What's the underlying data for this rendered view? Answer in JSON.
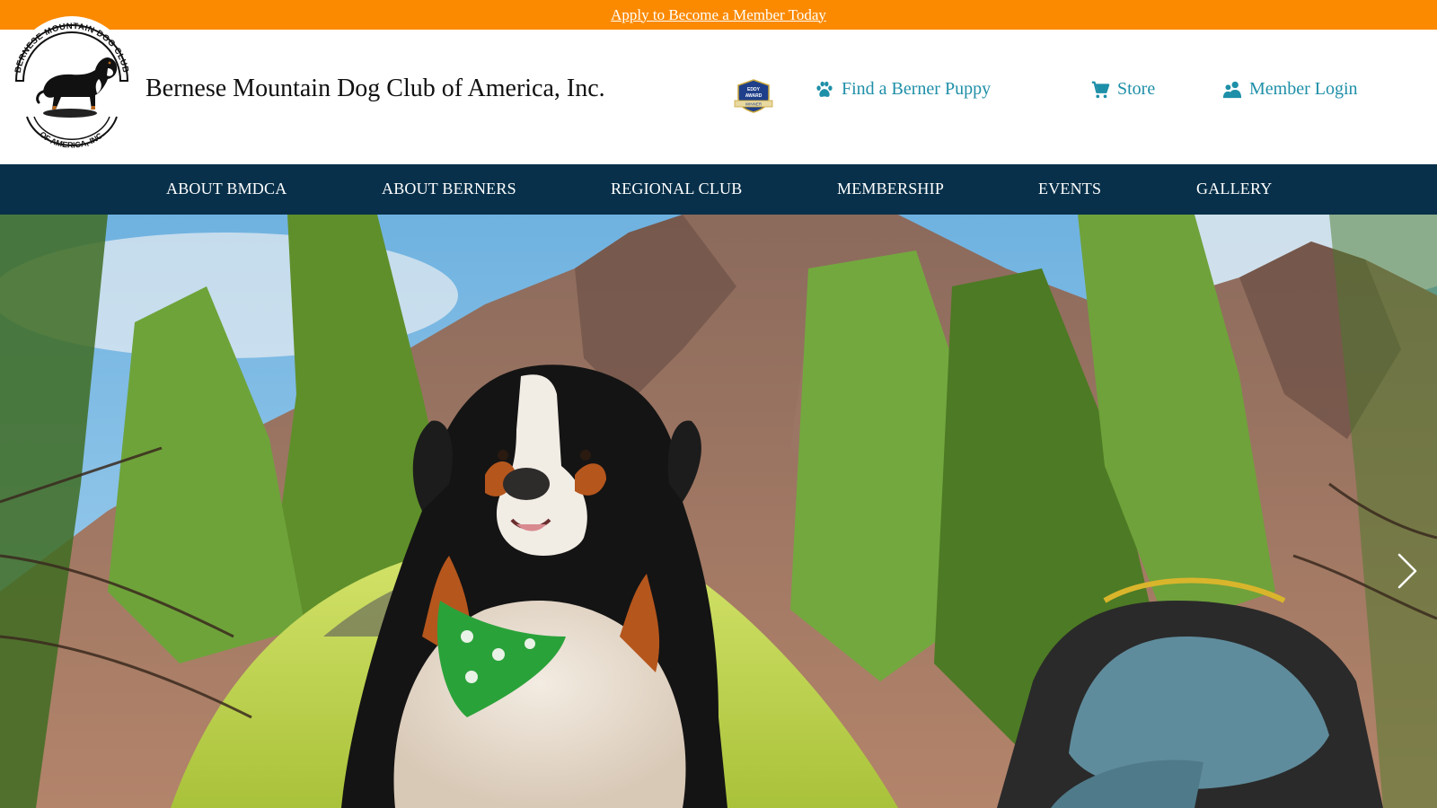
{
  "announcement": {
    "link_text": "Apply to Become a Member Today"
  },
  "header": {
    "logo_text_top": "BERNESE MOUNTAIN DOG CLUB",
    "logo_text_bottom": "OF AMERICA, INC.",
    "site_title": "Bernese Mountain Dog Club of America, Inc.",
    "badge_text_top": "EDDY",
    "badge_text_mid": "AWARD",
    "badge_text_bottom": "WINNER",
    "utility_links": {
      "puppy": "Find a Berner Puppy",
      "store": "Store",
      "login": "Member Login"
    }
  },
  "nav": {
    "items": [
      "ABOUT BMDCA",
      "ABOUT BERNERS",
      "REGIONAL CLUB",
      "MEMBERSHIP",
      "EVENTS",
      "GALLERY"
    ]
  },
  "icons": {
    "puppy": "paw-icon",
    "store": "cart-icon",
    "login": "members-icon",
    "carousel_next": "chevron-right-icon"
  },
  "colors": {
    "announcement_bg": "#fb8a00",
    "nav_bg": "#08304a",
    "utility_link": "#1e8fa8"
  }
}
